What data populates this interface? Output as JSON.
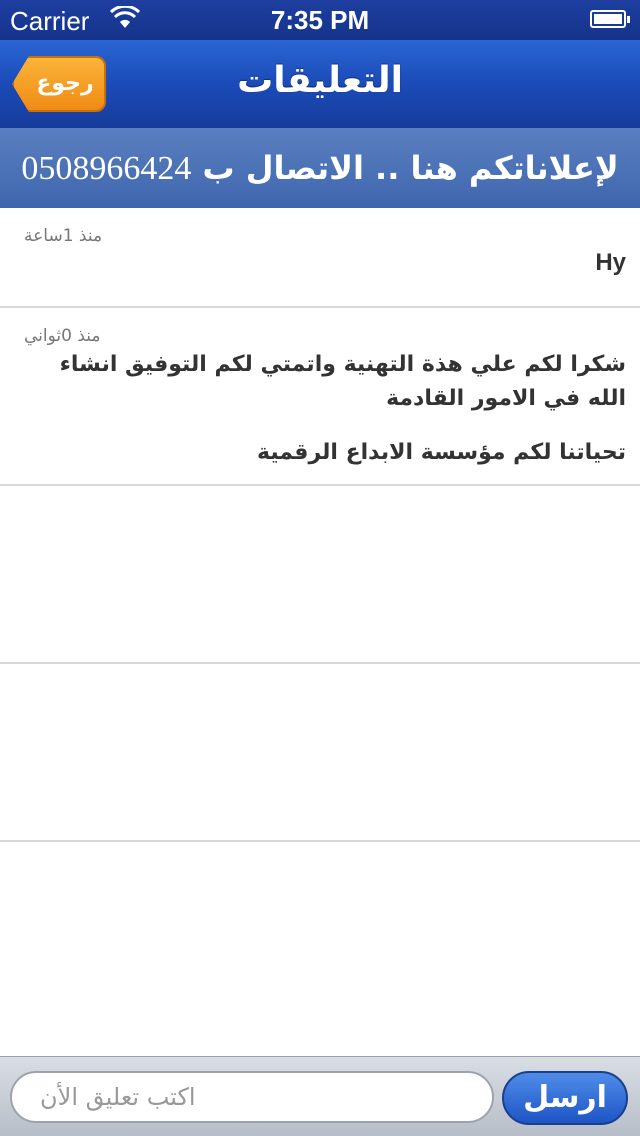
{
  "status_bar": {
    "carrier": "Carrier",
    "wifi_icon": "wifi-icon",
    "time": "7:35 PM",
    "battery_icon": "battery-icon"
  },
  "nav": {
    "title": "التعليقات",
    "back_label": "رجوع"
  },
  "ad_banner": {
    "text": "لإعلاناتكم هنا .. الاتصال ب",
    "phone": "0508966424"
  },
  "comments": [
    {
      "time_ago": "منذ 1ساعة",
      "text": "Hy"
    },
    {
      "time_ago": "منذ 0ثواني",
      "line1": "شكرا لكم علي هذة التهنية واتمتي لكم التوفيق انشاء الله في الامور القادمة",
      "line2": "تحياتنا لكم مؤسسة الابداع الرقمية"
    }
  ],
  "composer": {
    "placeholder": "اكتب تعليق الأن",
    "send_label": "ارسل"
  },
  "colors": {
    "nav_blue": "#1b4bb8",
    "banner_blue": "#4a70b5",
    "back_orange": "#f08b14"
  }
}
